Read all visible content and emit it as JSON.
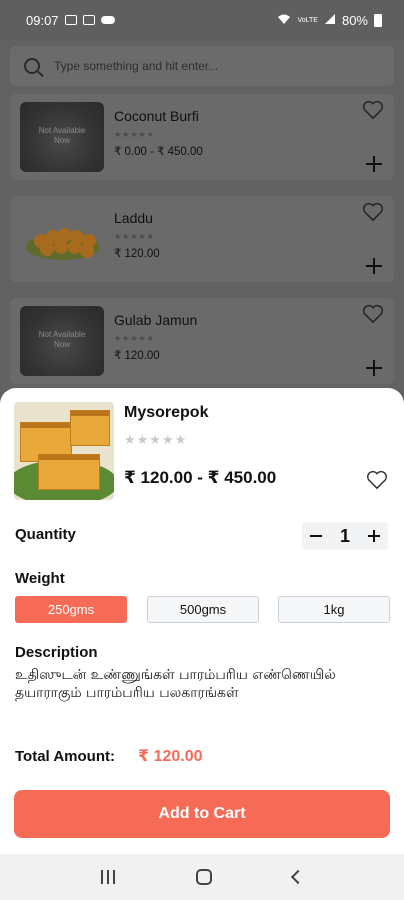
{
  "status_bar": {
    "time": "09:07",
    "battery": "80%",
    "signal_label": "VoLTE"
  },
  "search": {
    "placeholder": "Type something and hit enter..."
  },
  "products": [
    {
      "name": "Coconut Burfi",
      "stars": "★★★★★",
      "price": "₹ 0.00 - ₹ 450.00",
      "image_text": "Not Available Now"
    },
    {
      "name": "Laddu",
      "stars": "★★★★★",
      "price": "₹ 120.00"
    },
    {
      "name": "Gulab Jamun",
      "stars": "★★★★★",
      "price": "₹ 120.00",
      "image_text": "Not Available Now"
    }
  ],
  "detail": {
    "name": "Mysorepok",
    "stars": "★★★★★",
    "price_range": "₹ 120.00 - ₹ 450.00",
    "quantity_label": "Quantity",
    "quantity": "1",
    "weight_label": "Weight",
    "weights": [
      "250gms",
      "500gms",
      "1kg"
    ],
    "selected_weight": "250gms",
    "description_label": "Description",
    "description": "உதிஸுடன் உண்ணுங்கள் பாரம்பரிய எண்ணெயில் தயாராகும் பாரம்பரிய பலகாரங்கள்",
    "total_label": "Total Amount:",
    "total_value": "₹ 120.00",
    "add_to_cart": "Add to Cart"
  },
  "colors": {
    "accent": "#f56b56",
    "dim_overlay": "#5f5f5f"
  },
  "icons": [
    "search-icon",
    "heart-icon",
    "plus-icon",
    "minus-icon",
    "recent-apps-icon",
    "home-icon",
    "back-icon"
  ]
}
